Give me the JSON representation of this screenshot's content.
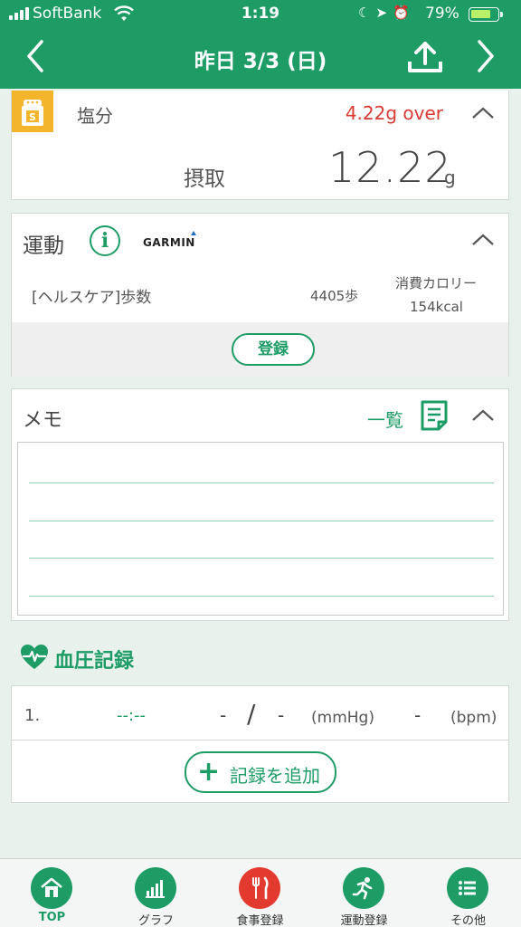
{
  "status_bar": {
    "carrier": "SoftBank",
    "time": "1:19",
    "battery_percent": "79%",
    "battery_level": 0.79
  },
  "header": {
    "title": "昨日 3/3 (日)",
    "prev_icon": "chevron-left-icon",
    "next_icon": "chevron-right-icon",
    "share_icon": "upload-icon"
  },
  "salt": {
    "label": "塩分",
    "over_text": "4.22g over",
    "intake_label": "摂取",
    "value": "12.22",
    "unit": "g",
    "icon_letter": "S"
  },
  "exercise": {
    "title": "運動",
    "brand": "GARMIN",
    "row": {
      "name": "[ヘルスケア]歩数",
      "steps": "4405歩",
      "calorie_label": "消費カロリー",
      "calorie_value": "154kcal"
    },
    "register_label": "登録"
  },
  "memo": {
    "title": "メモ",
    "list_label": "一覧"
  },
  "blood_pressure": {
    "heading": "血圧記録",
    "row": {
      "index": "1.",
      "time": "--:--",
      "systolic": "-",
      "slash": "/",
      "diastolic": "-",
      "unit_mmhg": "(mmHg)",
      "pulse": "-",
      "unit_bpm": "(bpm)"
    },
    "add_label": "記録を追加"
  },
  "tabbar": {
    "items": [
      {
        "label": "TOP",
        "icon": "home-icon",
        "active": true
      },
      {
        "label": "グラフ",
        "icon": "bar-chart-icon",
        "active": false
      },
      {
        "label": "食事登録",
        "icon": "fork-knife-icon",
        "active": false
      },
      {
        "label": "運動登録",
        "icon": "running-icon",
        "active": false
      },
      {
        "label": "その他",
        "icon": "list-icon",
        "active": false
      }
    ]
  },
  "colors": {
    "brand_green": "#1e9c66",
    "over_red": "#d83a33",
    "salt_yellow": "#f2b52b",
    "meal_red": "#e23a2f"
  }
}
